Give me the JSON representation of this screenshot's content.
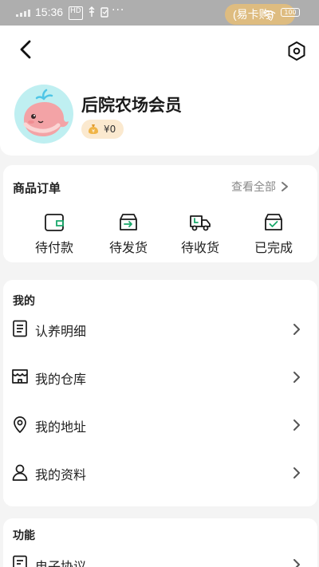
{
  "status_bar": {
    "time": "15:36",
    "icons": [
      "HD",
      "usb-icon",
      "clipboard-icon"
    ],
    "more": "···",
    "pill_text": "(易卡购)",
    "battery": "100"
  },
  "header": {
    "back_icon": "chevron-left-icon",
    "settings_icon": "hexagon-settings-icon"
  },
  "profile": {
    "name": "后院农场会员",
    "balance": "¥0",
    "avatar": "whale-avatar"
  },
  "orders": {
    "title": "商品订单",
    "view_all": "查看全部",
    "tabs": [
      {
        "label": "待付款",
        "icon": "wallet-icon"
      },
      {
        "label": "待发货",
        "icon": "box-arrow-icon"
      },
      {
        "label": "待收货",
        "icon": "truck-icon"
      },
      {
        "label": "已完成",
        "icon": "box-check-icon"
      }
    ]
  },
  "mine": {
    "title": "我的",
    "items": [
      {
        "label": "认养明细",
        "icon": "list-doc-icon"
      },
      {
        "label": "我的仓库",
        "icon": "store-icon"
      },
      {
        "label": "我的地址",
        "icon": "location-pin-icon"
      },
      {
        "label": "我的资料",
        "icon": "user-icon"
      }
    ]
  },
  "functions": {
    "title": "功能",
    "items": [
      {
        "label": "电子协议",
        "icon": "agreement-icon"
      }
    ]
  },
  "colors": {
    "accent_green": "#1aa86b",
    "badge_bg": "#fbe9cf",
    "avatar_bg": "#bfeff1"
  }
}
